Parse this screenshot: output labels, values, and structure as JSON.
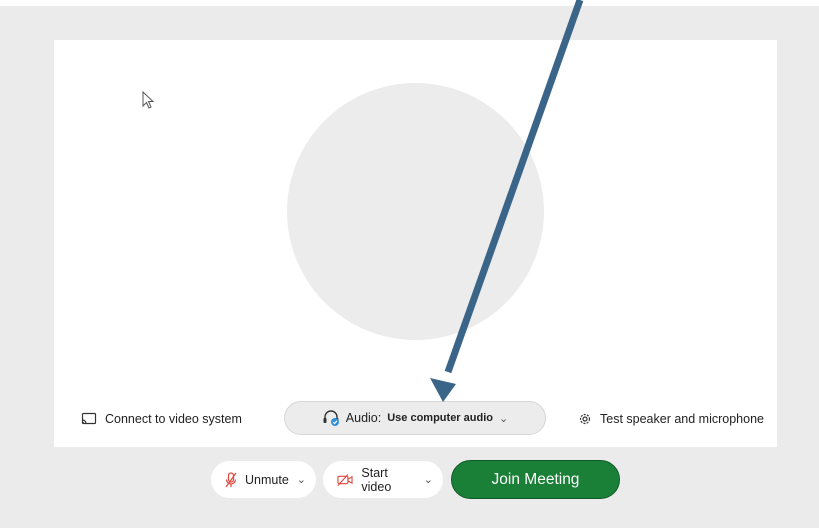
{
  "preview": {
    "connect_label": "Connect to video system",
    "audio_prefix": "Audio:",
    "audio_value": "Use computer audio",
    "audio_chevron": "⌄",
    "test_label": "Test speaker and microphone"
  },
  "controls": {
    "unmute_label": "Unmute",
    "start_video_label": "Start video",
    "chevron": "⌄",
    "join_label": "Join Meeting"
  },
  "icons": {
    "cursor": "mouse-pointer-icon",
    "cast": "cast-icon",
    "headset": "headset-icon",
    "gear": "gear-icon",
    "mic_muted": "mic-muted-icon",
    "video_off": "video-off-icon"
  },
  "colors": {
    "join_bg": "#1a7f37",
    "muted_red": "#e2463c",
    "annotation_arrow": "#3a6488",
    "audio_badge": "#2f8fd8"
  }
}
